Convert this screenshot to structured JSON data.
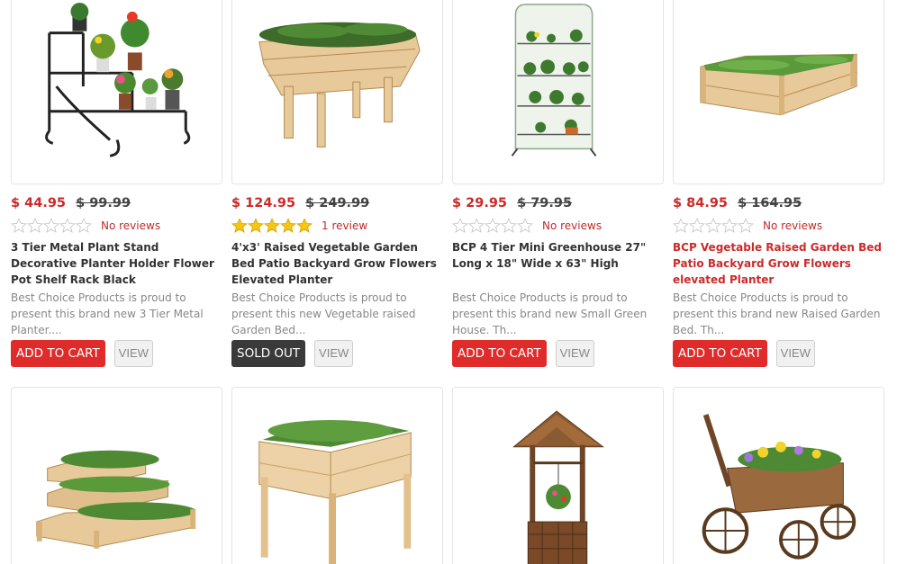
{
  "products": [
    {
      "price": "$ 44.95",
      "old_price": "$ 99.99",
      "rating_stars": 0,
      "reviews": "No reviews",
      "title": "3 Tier Metal Plant Stand Decorative Planter Holder Flower Pot Shelf Rack Black",
      "description": "Best Choice Products is proud to present this brand new 3 Tier Metal Planter....",
      "action": "ADD TO CART",
      "view": "VIEW",
      "image": "metal-plant-stand-image"
    },
    {
      "price": "$ 124.95",
      "old_price": "$ 249.99",
      "rating_stars": 5,
      "reviews": "1 review",
      "title": "4'x3' Raised Vegetable Garden Bed Patio Backyard Grow Flowers Elevated Planter",
      "description": "Best Choice Products is proud to present this new Vegetable raised Garden Bed...",
      "action": "SOLD OUT",
      "view": "VIEW",
      "image": "elevated-planter-image"
    },
    {
      "price": "$ 29.95",
      "old_price": "$ 79.95",
      "rating_stars": 0,
      "reviews": "No reviews",
      "title": "BCP 4 Tier Mini Greenhouse 27\" Long x 18\" Wide x 63\" High",
      "description": "Best Choice Products is proud to present this brand new Small Green House. Th...",
      "action": "ADD TO CART",
      "view": "VIEW",
      "image": "mini-greenhouse-image"
    },
    {
      "price": "$ 84.95",
      "old_price": "$ 164.95",
      "rating_stars": 0,
      "reviews": "No reviews",
      "title": "BCP Vegetable Raised Garden Bed Patio Backyard Grow Flowers elevated Planter",
      "description": "Best Choice Products is proud to present this brand new Raised Garden Bed. Th...",
      "action": "ADD TO CART",
      "view": "VIEW",
      "image": "raised-garden-bed-image"
    }
  ],
  "second_row_images": [
    "three-tier-garden-bed-image",
    "standing-planter-box-image",
    "wishing-well-planter-image",
    "wagon-planter-image"
  ],
  "colors": {
    "price": "#cc2a2a",
    "add_to_cart": "#e02b2b",
    "sold_out": "#3a3a3a",
    "star_filled": "#f5c518",
    "star_empty": "#c8c8c8"
  }
}
